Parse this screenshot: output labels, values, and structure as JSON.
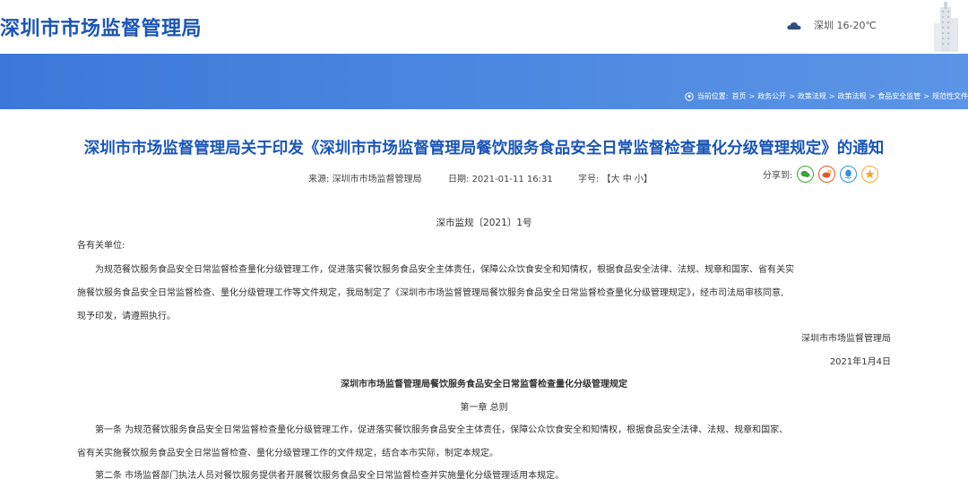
{
  "header": {
    "site_title": "深圳市市场监督管理局",
    "weather": "深圳 16-20℃"
  },
  "breadcrumb": {
    "prefix": "当前位置:",
    "items": [
      "首页",
      "政务公开",
      "政策法规",
      "政策法规",
      "食品安全监管",
      "规范性文件"
    ]
  },
  "article": {
    "title": "深圳市市场监督管理局关于印发《深圳市市场监督管理局餐饮服务食品安全日常监督检查量化分级管理规定》的通知",
    "source_label": "来源:",
    "source": "深圳市市场监督管理局",
    "date_label": "日期:",
    "date": "2021-01-11 16:31",
    "fontsize_label": "字号:",
    "fontsize_options": "【大 中 小】",
    "share_label": "分享到:",
    "doc_number": "深市监规〔2021〕1号",
    "salutation": "各有关单位:",
    "para1_line1": "为规范餐饮服务食品安全日常监督检查量化分级管理工作，促进落实餐饮服务食品安全主体责任，保障公众饮食安全和知情权，根据食品安全法律、法规、规章和国家、省有关实",
    "para1_line2": "施餐饮服务食品安全日常监督检查、量化分级管理工作等文件规定，我局制定了《深圳市市场监督管理局餐饮服务食品安全日常监督检查量化分级管理规定》，经市司法局审核同意,",
    "para1_line3": "现予印发，请遵照执行。",
    "signature": "深圳市市场监督管理局",
    "sign_date": "2021年1月4日",
    "regulation_title": "深圳市市场监督管理局餐饮服务食品安全日常监督检查量化分级管理规定",
    "chapter1": "第一章 总则",
    "article1_line1": "第一条 为规范餐饮服务食品安全日常监督检查量化分级管理工作，促进落实餐饮服务食品安全主体责任，保障公众饮食安全和知情权，根据食品安全法律、法规、规章和国家、",
    "article1_line2": "省有关实施餐饮服务食品安全日常监督检查、量化分级管理工作的文件规定，结合本市实际，制定本规定。",
    "article2": "第二条 市场监督部门执法人员对餐饮服务提供者开展餐饮服务食品安全日常监督检查并实施量化分级管理适用本规定。"
  },
  "colors": {
    "brand_blue": "#1a56b8",
    "banner_blue": "#4a86df",
    "wechat": "#3aa537",
    "weibo": "#e2562d",
    "qq": "#2f8fe8",
    "qzone": "#f1a52b"
  }
}
